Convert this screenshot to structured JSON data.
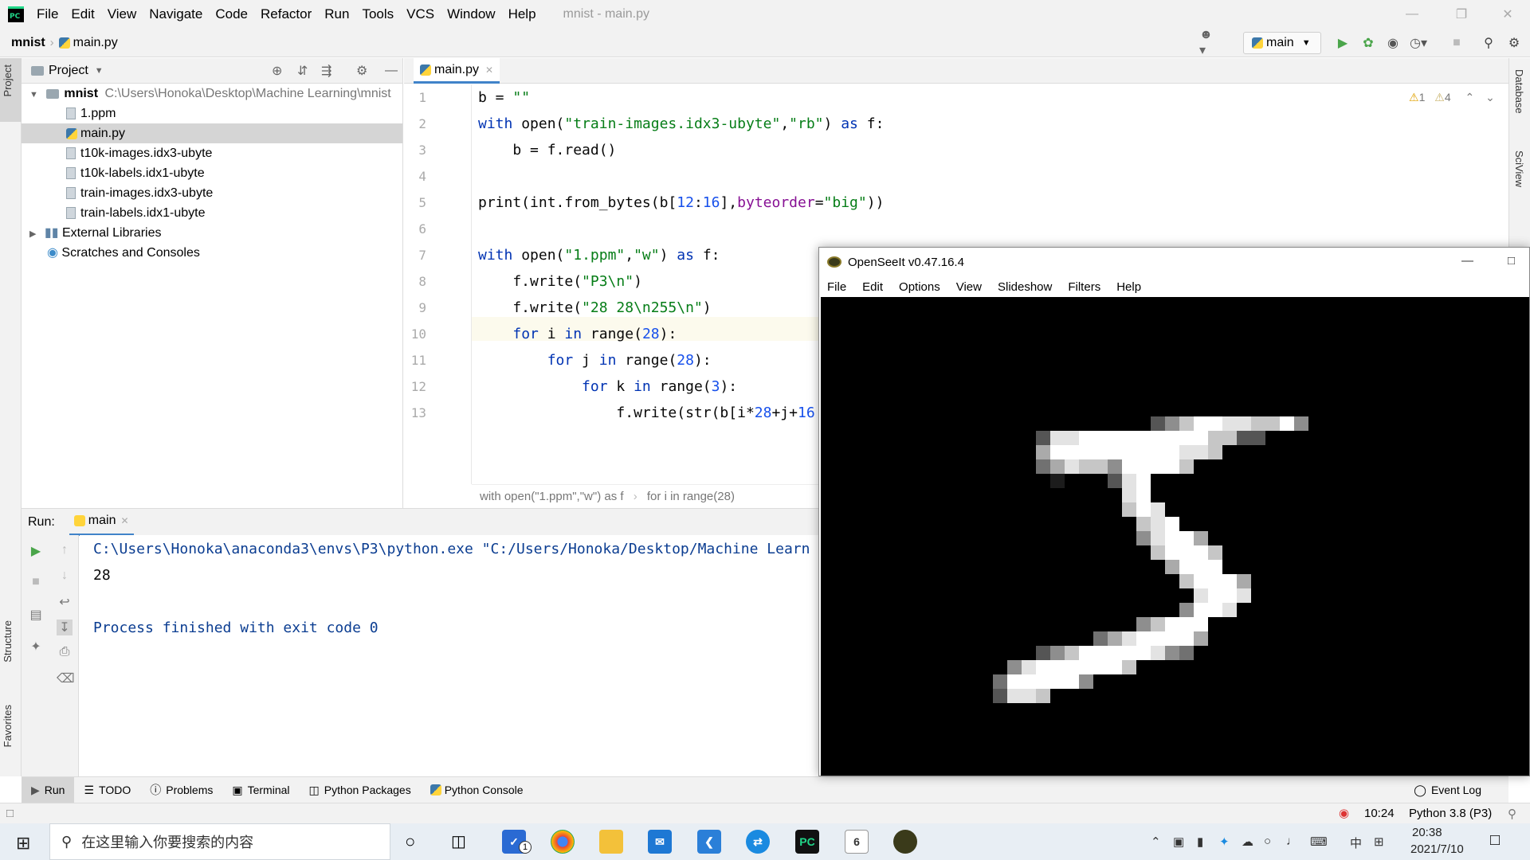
{
  "ide": {
    "menu": [
      "File",
      "Edit",
      "View",
      "Navigate",
      "Code",
      "Refactor",
      "Run",
      "Tools",
      "VCS",
      "Window",
      "Help"
    ],
    "window_title": "mnist - main.py",
    "breadcrumb": {
      "project": "mnist",
      "file": "main.py"
    },
    "run_config": "main",
    "side_tabs": {
      "project": "Project",
      "structure": "Structure",
      "favorites": "Favorites",
      "database": "Database",
      "sciview": "SciView"
    }
  },
  "project_panel": {
    "title": "Project",
    "root": {
      "name": "mnist",
      "path": "C:\\Users\\Honoka\\Desktop\\Machine Learning\\mnist"
    },
    "files": [
      "1.ppm",
      "main.py",
      "t10k-images.idx3-ubyte",
      "t10k-labels.idx1-ubyte",
      "train-images.idx3-ubyte",
      "train-labels.idx1-ubyte"
    ],
    "external": "External Libraries",
    "scratches": "Scratches and Consoles"
  },
  "editor": {
    "tab": "main.py",
    "line_numbers": [
      "1",
      "2",
      "3",
      "4",
      "5",
      "6",
      "7",
      "8",
      "9",
      "10",
      "11",
      "12",
      "13"
    ],
    "inspections": {
      "warnings": "1",
      "weak_warnings": "4"
    },
    "breadcrumb": [
      "with open(\"1.ppm\",\"w\") as f",
      "for i in range(28)"
    ]
  },
  "run_panel": {
    "label": "Run:",
    "tab": "main",
    "output": [
      "C:\\Users\\Honoka\\anaconda3\\envs\\P3\\python.exe \"C:/Users/Honoka/Desktop/Machine Learn",
      "28",
      "",
      "Process finished with exit code 0"
    ]
  },
  "bottom_tabs": [
    "Run",
    "TODO",
    "Problems",
    "Terminal",
    "Python Packages",
    "Python Console"
  ],
  "event_log": "Event Log",
  "status": {
    "position": "10:24",
    "interpreter": "Python 3.8 (P3)"
  },
  "viewer": {
    "title": "OpenSeeIt v0.47.16.4",
    "menu": [
      "File",
      "Edit",
      "Options",
      "View",
      "Slideshow",
      "Filters",
      "Help"
    ]
  },
  "taskbar": {
    "search_placeholder": "在这里输入你要搜索的内容",
    "time": "20:38",
    "date": "2021/7/10",
    "ime": "中",
    "badge": "1"
  }
}
